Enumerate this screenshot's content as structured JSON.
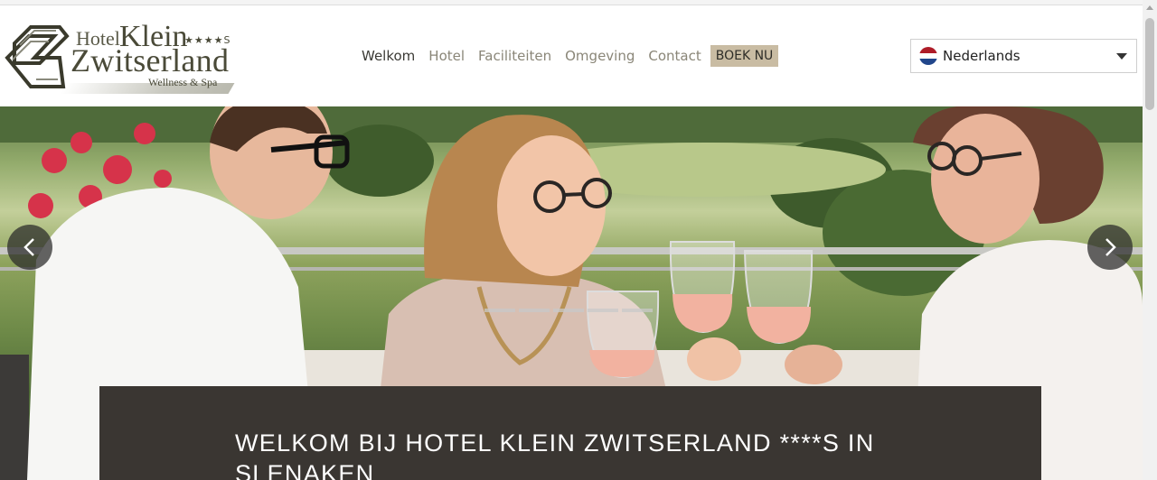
{
  "logo": {
    "hotel": "Hotel",
    "klein": "Klein",
    "stars": "★★★★S",
    "zwitserland": "Zwitserland",
    "subtitle": "Wellness & Spa"
  },
  "nav": {
    "items": [
      "Welkom",
      "Hotel",
      "Faciliteiten",
      "Omgeving",
      "Contact"
    ],
    "active": "Welkom",
    "book_label": "BOEK NU"
  },
  "language": {
    "selected": "Nederlands",
    "flag_colors": [
      "#ae1c28",
      "#ffffff",
      "#21468b"
    ]
  },
  "hero": {
    "slide_count": 5,
    "prev_icon": "chevron-left-icon",
    "next_icon": "chevron-right-icon"
  },
  "welcome": {
    "heading": "WELKOM BIJ HOTEL KLEIN ZWITSERLAND ****S IN SLENAKEN"
  },
  "colors": {
    "accent": "#c9bca3",
    "panel": "#3a3632",
    "nav_text": "#8a8678"
  }
}
